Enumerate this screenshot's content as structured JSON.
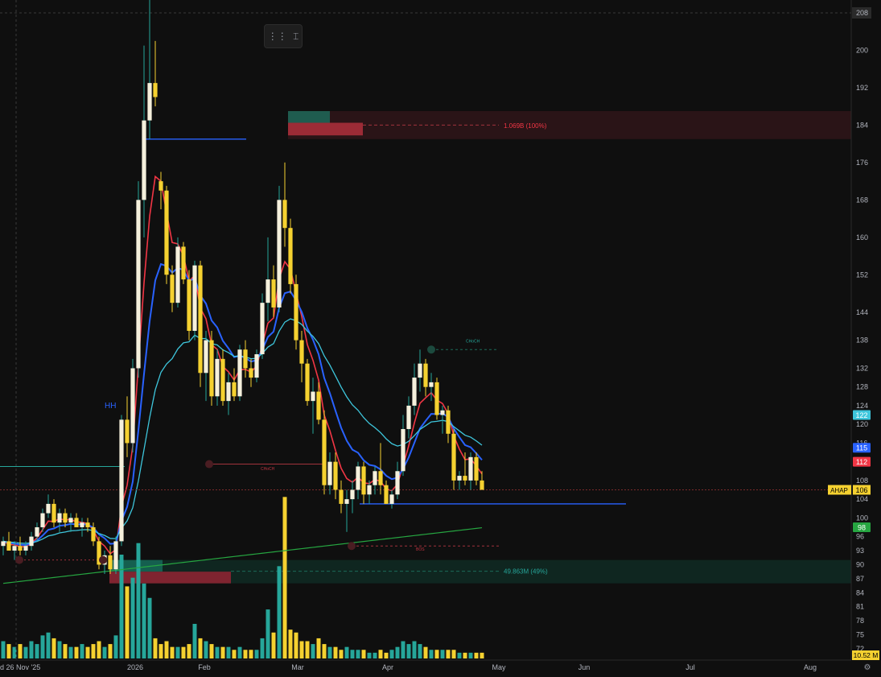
{
  "chart_data": {
    "type": "candlestick",
    "symbol": "AHAP",
    "last_price": "106",
    "volume_last": "10.52 M",
    "y_axis_ticks": [
      "208",
      "200",
      "192",
      "184",
      "176",
      "168",
      "160",
      "152",
      "144",
      "138",
      "132",
      "128",
      "124",
      "120",
      "116",
      "108",
      "104",
      "100",
      "96",
      "93",
      "90",
      "87",
      "84",
      "81",
      "78",
      "75",
      "72"
    ],
    "x_axis_ticks": [
      "d 26 Nov '25",
      "2026",
      "Feb",
      "Mar",
      "Apr",
      "May",
      "Jun",
      "Jul",
      "Aug"
    ],
    "price_labels": [
      {
        "text": "122",
        "color": "#3ec6dc",
        "value": 122
      },
      {
        "text": "115",
        "color": "#2962ff",
        "value": 115
      },
      {
        "text": "112",
        "color": "#f23645",
        "value": 112
      },
      {
        "text": "98",
        "color": "#26a641",
        "value": 98
      }
    ],
    "annotations": {
      "hh": "HH",
      "choch_top": "CHoCH",
      "choch_mid": "CHoCH",
      "bos": "BOS",
      "vp_top": "1.069B (100%)",
      "vp_bottom": "49.863M (49%)"
    },
    "candles": [
      {
        "o": 94,
        "h": 96,
        "l": 92,
        "c": 95,
        "v": 6
      },
      {
        "o": 95,
        "h": 97,
        "l": 93,
        "c": 93,
        "v": 5
      },
      {
        "o": 93,
        "h": 95,
        "l": 91,
        "c": 94,
        "v": 4
      },
      {
        "o": 94,
        "h": 96,
        "l": 92,
        "c": 93,
        "v": 5
      },
      {
        "o": 93,
        "h": 95,
        "l": 92,
        "c": 94,
        "v": 4
      },
      {
        "o": 94,
        "h": 97,
        "l": 93,
        "c": 96,
        "v": 6
      },
      {
        "o": 96,
        "h": 99,
        "l": 95,
        "c": 98,
        "v": 5
      },
      {
        "o": 98,
        "h": 102,
        "l": 97,
        "c": 101,
        "v": 8
      },
      {
        "o": 101,
        "h": 105,
        "l": 100,
        "c": 103,
        "v": 9
      },
      {
        "o": 103,
        "h": 104,
        "l": 98,
        "c": 99,
        "v": 7
      },
      {
        "o": 99,
        "h": 102,
        "l": 97,
        "c": 101,
        "v": 6
      },
      {
        "o": 101,
        "h": 102,
        "l": 98,
        "c": 99,
        "v": 5
      },
      {
        "o": 99,
        "h": 101,
        "l": 97,
        "c": 100,
        "v": 4
      },
      {
        "o": 100,
        "h": 101,
        "l": 98,
        "c": 98,
        "v": 4
      },
      {
        "o": 98,
        "h": 100,
        "l": 96,
        "c": 99,
        "v": 5
      },
      {
        "o": 99,
        "h": 100,
        "l": 97,
        "c": 98,
        "v": 4
      },
      {
        "o": 98,
        "h": 99,
        "l": 94,
        "c": 95,
        "v": 5
      },
      {
        "o": 95,
        "h": 96,
        "l": 89,
        "c": 90,
        "v": 6
      },
      {
        "o": 90,
        "h": 93,
        "l": 88,
        "c": 92,
        "v": 4
      },
      {
        "o": 92,
        "h": 94,
        "l": 88,
        "c": 89,
        "v": 5
      },
      {
        "o": 89,
        "h": 96,
        "l": 88,
        "c": 95,
        "v": 8
      },
      {
        "o": 95,
        "h": 122,
        "l": 94,
        "c": 121,
        "v": 36
      },
      {
        "o": 121,
        "h": 126,
        "l": 113,
        "c": 116,
        "v": 25
      },
      {
        "o": 116,
        "h": 134,
        "l": 114,
        "c": 132,
        "v": 28
      },
      {
        "o": 132,
        "h": 172,
        "l": 130,
        "c": 168,
        "v": 40
      },
      {
        "o": 168,
        "h": 201,
        "l": 160,
        "c": 185,
        "v": 26
      },
      {
        "o": 185,
        "h": 212,
        "l": 181,
        "c": 193,
        "v": 21
      },
      {
        "o": 193,
        "h": 202,
        "l": 188,
        "c": 190,
        "v": 7
      },
      {
        "o": 172,
        "h": 174,
        "l": 166,
        "c": 170,
        "v": 5
      },
      {
        "o": 170,
        "h": 171,
        "l": 150,
        "c": 152,
        "v": 6
      },
      {
        "o": 152,
        "h": 154,
        "l": 144,
        "c": 146,
        "v": 4
      },
      {
        "o": 146,
        "h": 160,
        "l": 145,
        "c": 158,
        "v": 4
      },
      {
        "o": 158,
        "h": 159,
        "l": 150,
        "c": 151,
        "v": 4
      },
      {
        "o": 151,
        "h": 153,
        "l": 138,
        "c": 140,
        "v": 5
      },
      {
        "o": 140,
        "h": 155,
        "l": 138,
        "c": 154,
        "v": 12
      },
      {
        "o": 154,
        "h": 155,
        "l": 128,
        "c": 131,
        "v": 7
      },
      {
        "o": 131,
        "h": 140,
        "l": 125,
        "c": 138,
        "v": 6
      },
      {
        "o": 138,
        "h": 140,
        "l": 124,
        "c": 126,
        "v": 5
      },
      {
        "o": 126,
        "h": 136,
        "l": 124,
        "c": 134,
        "v": 4
      },
      {
        "o": 134,
        "h": 136,
        "l": 124,
        "c": 125,
        "v": 4
      },
      {
        "o": 125,
        "h": 131,
        "l": 122,
        "c": 129,
        "v": 4
      },
      {
        "o": 129,
        "h": 132,
        "l": 125,
        "c": 126,
        "v": 3
      },
      {
        "o": 126,
        "h": 137,
        "l": 125,
        "c": 136,
        "v": 4
      },
      {
        "o": 136,
        "h": 138,
        "l": 130,
        "c": 132,
        "v": 3
      },
      {
        "o": 132,
        "h": 134,
        "l": 128,
        "c": 130,
        "v": 3
      },
      {
        "o": 130,
        "h": 136,
        "l": 129,
        "c": 135,
        "v": 3
      },
      {
        "o": 135,
        "h": 148,
        "l": 134,
        "c": 146,
        "v": 7
      },
      {
        "o": 146,
        "h": 160,
        "l": 142,
        "c": 151,
        "v": 17
      },
      {
        "o": 151,
        "h": 154,
        "l": 143,
        "c": 145,
        "v": 9
      },
      {
        "o": 145,
        "h": 171,
        "l": 144,
        "c": 168,
        "v": 32
      },
      {
        "o": 168,
        "h": 176,
        "l": 158,
        "c": 162,
        "v": 56
      },
      {
        "o": 162,
        "h": 164,
        "l": 148,
        "c": 150,
        "v": 10
      },
      {
        "o": 150,
        "h": 152,
        "l": 136,
        "c": 138,
        "v": 9
      },
      {
        "o": 138,
        "h": 140,
        "l": 129,
        "c": 133,
        "v": 6
      },
      {
        "o": 133,
        "h": 134,
        "l": 124,
        "c": 125,
        "v": 6
      },
      {
        "o": 125,
        "h": 130,
        "l": 118,
        "c": 127,
        "v": 5
      },
      {
        "o": 127,
        "h": 129,
        "l": 120,
        "c": 121,
        "v": 7
      },
      {
        "o": 121,
        "h": 123,
        "l": 105,
        "c": 107,
        "v": 5
      },
      {
        "o": 107,
        "h": 114,
        "l": 105,
        "c": 112,
        "v": 4
      },
      {
        "o": 112,
        "h": 114,
        "l": 104,
        "c": 106,
        "v": 4
      },
      {
        "o": 106,
        "h": 108,
        "l": 101,
        "c": 103,
        "v": 3
      },
      {
        "o": 103,
        "h": 106,
        "l": 97,
        "c": 104,
        "v": 4
      },
      {
        "o": 104,
        "h": 108,
        "l": 101,
        "c": 106,
        "v": 3
      },
      {
        "o": 106,
        "h": 112,
        "l": 104,
        "c": 111,
        "v": 3
      },
      {
        "o": 111,
        "h": 112,
        "l": 103,
        "c": 105,
        "v": 3
      },
      {
        "o": 105,
        "h": 108,
        "l": 103,
        "c": 107,
        "v": 2
      },
      {
        "o": 107,
        "h": 111,
        "l": 105,
        "c": 110,
        "v": 2
      },
      {
        "o": 110,
        "h": 116,
        "l": 105,
        "c": 107,
        "v": 3
      },
      {
        "o": 107,
        "h": 108,
        "l": 103,
        "c": 103,
        "v": 2
      },
      {
        "o": 103,
        "h": 106,
        "l": 102,
        "c": 105,
        "v": 3
      },
      {
        "o": 105,
        "h": 112,
        "l": 104,
        "c": 110,
        "v": 4
      },
      {
        "o": 110,
        "h": 122,
        "l": 109,
        "c": 119,
        "v": 6
      },
      {
        "o": 119,
        "h": 126,
        "l": 117,
        "c": 124,
        "v": 5
      },
      {
        "o": 124,
        "h": 133,
        "l": 122,
        "c": 130,
        "v": 6
      },
      {
        "o": 130,
        "h": 136,
        "l": 127,
        "c": 133,
        "v": 5
      },
      {
        "o": 133,
        "h": 134,
        "l": 126,
        "c": 128,
        "v": 4
      },
      {
        "o": 128,
        "h": 131,
        "l": 125,
        "c": 129,
        "v": 3
      },
      {
        "o": 129,
        "h": 130,
        "l": 121,
        "c": 122,
        "v": 3
      },
      {
        "o": 122,
        "h": 124,
        "l": 118,
        "c": 123,
        "v": 3
      },
      {
        "o": 123,
        "h": 124,
        "l": 116,
        "c": 118,
        "v": 3
      },
      {
        "o": 118,
        "h": 119,
        "l": 106,
        "c": 108,
        "v": 3
      },
      {
        "o": 108,
        "h": 110,
        "l": 106,
        "c": 109,
        "v": 2
      },
      {
        "o": 109,
        "h": 114,
        "l": 107,
        "c": 108,
        "v": 2
      },
      {
        "o": 108,
        "h": 114,
        "l": 106,
        "c": 113,
        "v": 2
      },
      {
        "o": 113,
        "h": 114,
        "l": 107,
        "c": 108,
        "v": 2
      },
      {
        "o": 108,
        "h": 110,
        "l": 106,
        "c": 106,
        "v": 2
      }
    ]
  }
}
